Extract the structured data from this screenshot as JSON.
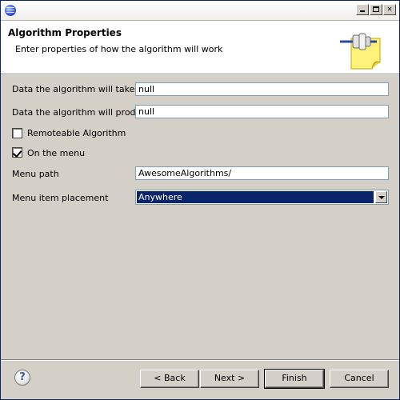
{
  "window": {
    "title": "",
    "controls": [
      "minimize",
      "maximize",
      "close"
    ]
  },
  "header": {
    "title": "Algorithm Properties",
    "subtitle": "Enter properties of how the algorithm will work",
    "icon": "plugin-note-icon"
  },
  "form": {
    "input_label": "Data the algorithm will take in",
    "input_value": "null",
    "output_label": "Data the algorithm will produce",
    "output_value": "null",
    "remoteable_label": "Remoteable Algorithm",
    "remoteable_checked": false,
    "on_menu_label": "On the menu",
    "on_menu_checked": true,
    "menu_path_label": "Menu path",
    "menu_path_value": "AwesomeAlgorithms/",
    "placement_label": "Menu item placement",
    "placement_value": "Anywhere"
  },
  "footer": {
    "help_label": "?",
    "back_label": "< Back",
    "next_label": "Next >",
    "finish_label": "Finish",
    "cancel_label": "Cancel"
  },
  "colors": {
    "selection": "#0a246a",
    "dialog_bg": "#d4d0c8",
    "input_border": "#7f9db9"
  }
}
